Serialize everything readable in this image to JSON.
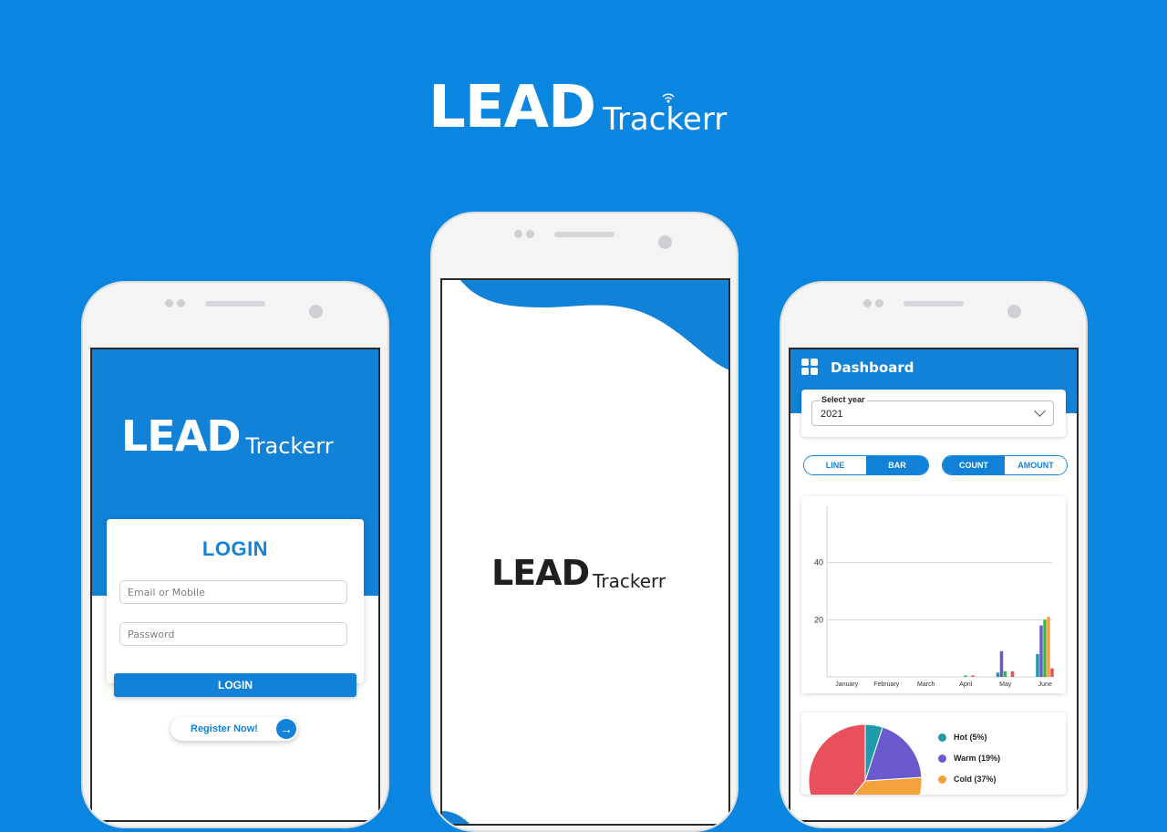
{
  "brand": {
    "lead_text": "LEAD",
    "trackerr_text": "Trackerr",
    "colors": {
      "background": "#0b86e0",
      "primary": "#1182d8",
      "dark": "#1f1f1f"
    }
  },
  "login_screen": {
    "title": "LOGIN",
    "email_placeholder": "Email or Mobile",
    "password_placeholder": "Password",
    "login_button": "LOGIN",
    "register_button": "Register Now!",
    "register_icon": "arrow-right-icon"
  },
  "splash_screen": {
    "logo": "LEAD Trackerr"
  },
  "dashboard": {
    "title": "Dashboard",
    "menu_icon": "grid-icon",
    "year_label": "Select year",
    "year_value": "2021",
    "chart_mode": {
      "line": "LINE",
      "bar": "BAR",
      "selected": "BAR"
    },
    "metric_mode": {
      "count": "COUNT",
      "amount": "AMOUNT",
      "selected": "COUNT"
    },
    "legend": [
      {
        "label": "Hot (5%)",
        "color": "#1e9aa8"
      },
      {
        "label": "Warm (19%)",
        "color": "#6a5acd"
      },
      {
        "label": "Cold (37%)",
        "color": "#f5a13c"
      }
    ]
  },
  "chart_data": [
    {
      "type": "bar",
      "categories": [
        "January",
        "February",
        "March",
        "April",
        "May",
        "June"
      ],
      "y_ticks": [
        "20",
        "40"
      ],
      "ylim": [
        0,
        60
      ],
      "grid": true,
      "series": [
        {
          "color": "#1e9aa8",
          "values": [
            0,
            0,
            0,
            0,
            1.5,
            8
          ]
        },
        {
          "color": "#6a5acd",
          "values": [
            0,
            0,
            0,
            0,
            9,
            18
          ]
        },
        {
          "color": "#3cb44b",
          "values": [
            0,
            0,
            0,
            0.5,
            2,
            20
          ]
        },
        {
          "color": "#f5a13c",
          "values": [
            0,
            0,
            0,
            0,
            0,
            21
          ]
        },
        {
          "color": "#e8505b",
          "values": [
            0,
            0,
            0,
            0.5,
            2,
            3
          ]
        }
      ]
    },
    {
      "type": "pie",
      "values": [
        5,
        19,
        37,
        39
      ],
      "colors": [
        "#1e9aa8",
        "#6a5acd",
        "#f5a13c",
        "#e8505b"
      ]
    }
  ]
}
